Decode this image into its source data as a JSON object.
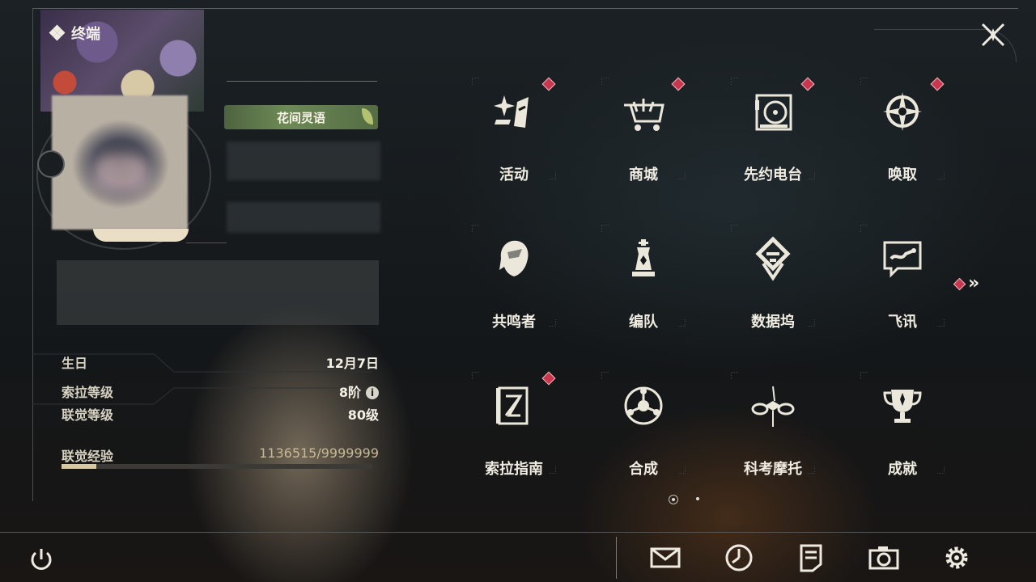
{
  "terminal": {
    "title": "终端",
    "icon": "diamond-icon"
  },
  "profile": {
    "title_badge": "花间灵语",
    "stats": [
      {
        "key": "生日",
        "value": "12月7日"
      },
      {
        "key": "索拉等级",
        "value": "8阶",
        "info": "i"
      },
      {
        "key": "联觉等级",
        "value": "80级"
      }
    ],
    "exp": {
      "key": "联觉经验",
      "value": "1136515/9999999",
      "progress": 0.113
    }
  },
  "menu": {
    "items": [
      {
        "label": "活动",
        "icon": "activity-sparkle-icon",
        "badge": true
      },
      {
        "label": "商城",
        "icon": "shop-cart-icon",
        "badge": true
      },
      {
        "label": "先约电台",
        "icon": "radio-vinyl-icon",
        "badge": true
      },
      {
        "label": "唤取",
        "icon": "summon-compass-icon",
        "badge": true
      },
      {
        "label": "共鸣者",
        "icon": "resonator-portrait-icon",
        "badge": false
      },
      {
        "label": "编队",
        "icon": "team-chess-icon",
        "badge": false
      },
      {
        "label": "数据坞",
        "icon": "data-dock-icon",
        "badge": false
      },
      {
        "label": "飞讯",
        "icon": "message-bubble-icon",
        "badge": false
      },
      {
        "label": "索拉指南",
        "icon": "guide-book-icon",
        "badge": true
      },
      {
        "label": "合成",
        "icon": "synthesis-orb-icon",
        "badge": false
      },
      {
        "label": "科考摩托",
        "icon": "motorcycle-icon",
        "badge": false
      },
      {
        "label": "成就",
        "icon": "trophy-icon",
        "badge": false
      }
    ],
    "more": "»",
    "pages": {
      "current": 1,
      "total": 2
    }
  },
  "bottom_bar": {
    "icons": [
      "mail-icon",
      "clock-icon",
      "notes-icon",
      "camera-icon",
      "settings-gear-icon"
    ]
  },
  "colors": {
    "badge": "#c8374e",
    "accent": "#d8c9a4",
    "text": "#f0ece2"
  }
}
